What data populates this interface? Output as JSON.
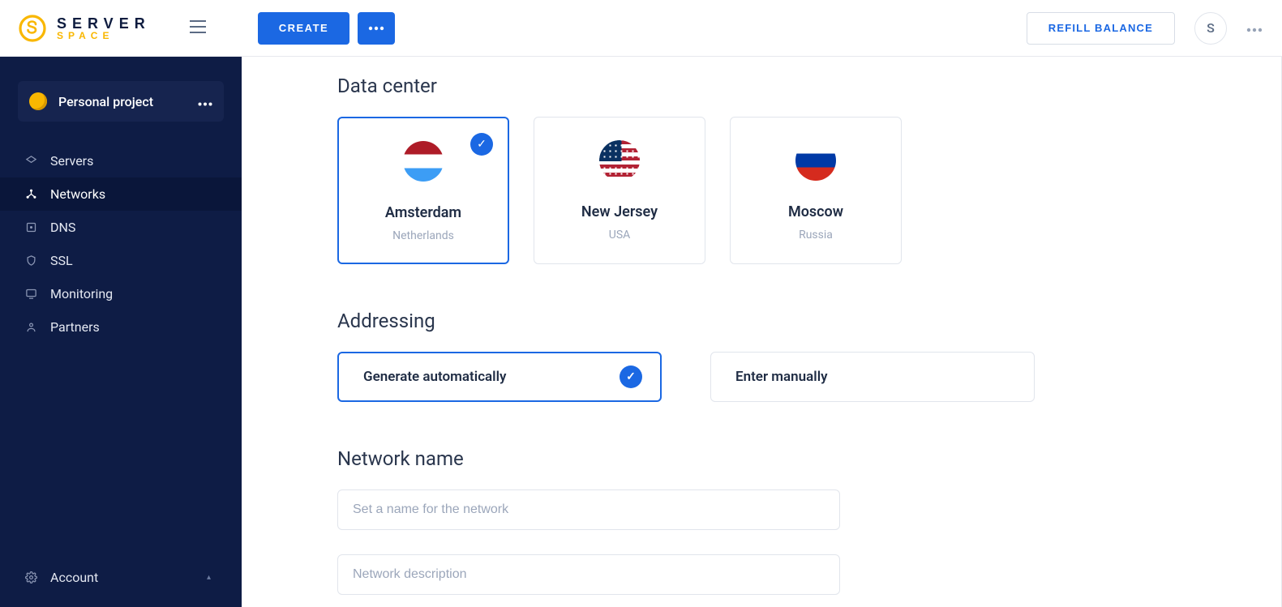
{
  "brand": {
    "name_top": "SERVER",
    "name_bottom": "SPACE"
  },
  "topbar": {
    "create_label": "CREATE",
    "refill_label": "REFILL BALANCE",
    "avatar_initial": "S"
  },
  "sidebar": {
    "project_name": "Personal project",
    "items": [
      {
        "label": "Servers",
        "icon": "servers-icon",
        "active": false
      },
      {
        "label": "Networks",
        "icon": "networks-icon",
        "active": true
      },
      {
        "label": "DNS",
        "icon": "dns-icon",
        "active": false
      },
      {
        "label": "SSL",
        "icon": "ssl-icon",
        "active": false
      },
      {
        "label": "Monitoring",
        "icon": "monitoring-icon",
        "active": false
      },
      {
        "label": "Partners",
        "icon": "partners-icon",
        "active": false
      }
    ],
    "account_label": "Account"
  },
  "main": {
    "datacenter_title": "Data center",
    "datacenters": [
      {
        "city": "Amsterdam",
        "country": "Netherlands",
        "flag": "nl",
        "selected": true
      },
      {
        "city": "New Jersey",
        "country": "USA",
        "flag": "us",
        "selected": false
      },
      {
        "city": "Moscow",
        "country": "Russia",
        "flag": "ru",
        "selected": false
      }
    ],
    "addressing_title": "Addressing",
    "addressing_options": [
      {
        "label": "Generate automatically",
        "selected": true
      },
      {
        "label": "Enter manually",
        "selected": false
      }
    ],
    "network_name_title": "Network name",
    "network_name_placeholder": "Set a name for the network",
    "network_desc_placeholder": "Network description",
    "network_name_value": "",
    "network_desc_value": ""
  }
}
